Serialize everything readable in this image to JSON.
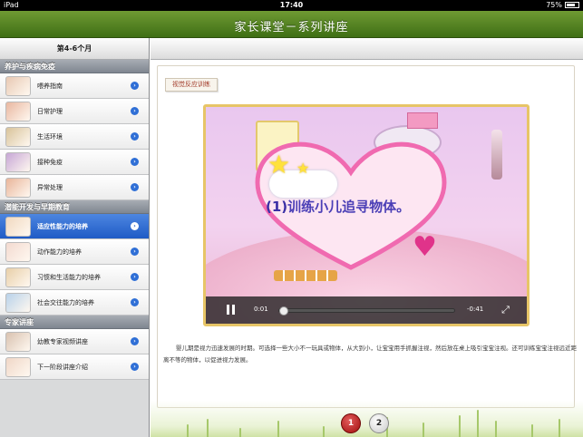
{
  "status_bar": {
    "device": "iPad",
    "time": "17:40",
    "battery": "75%",
    "battery_level": 0.75
  },
  "title_bar": {
    "title": "家长课堂－系列讲座"
  },
  "sidebar": {
    "header": "第4-6个月",
    "groups": [
      {
        "title": "养护与疾病免疫",
        "items": [
          {
            "label": "喂养指南",
            "thumb_color": "#e8c9b3"
          },
          {
            "label": "日常护理",
            "thumb_color": "#e9b7a0"
          },
          {
            "label": "生活环境",
            "thumb_color": "#d8c39a"
          },
          {
            "label": "接种免疫",
            "thumb_color": "#c7a7d6"
          },
          {
            "label": "异常处理",
            "thumb_color": "#e9b59a"
          }
        ]
      },
      {
        "title": "潜能开发与早期教育",
        "items": [
          {
            "label": "适应性能力的培养",
            "thumb_color": "#f1d9c0",
            "selected": true
          },
          {
            "label": "动作能力的培养",
            "thumb_color": "#f3dad0"
          },
          {
            "label": "习惯和生活能力的培养",
            "thumb_color": "#e8cfa8"
          },
          {
            "label": "社会交往能力的培养",
            "thumb_color": "#b9d2ea"
          }
        ]
      },
      {
        "title": "专家讲座",
        "items": [
          {
            "label": "幼教专家视频讲座",
            "thumb_color": "#d9c2b0"
          },
          {
            "label": "下一阶段讲座介绍",
            "thumb_color": "#f0d7c7"
          }
        ]
      }
    ]
  },
  "main": {
    "section_tag": "视觉反应训练",
    "video": {
      "caption_number": "(1)",
      "caption_text": "训练小儿追寻物体。",
      "current_time": "0:01",
      "remaining_time": "-0:41",
      "progress": 0.02
    },
    "description": "婴儿期是视力迅速发展的时期。可选择一些大小不一玩具或物体，从大到小，让宝宝用手抓握注视，然后放在桌上吸引宝宝注视。还可训练宝宝注视远近距离不等的物体，以促进视力发展。",
    "pagination": {
      "pages": [
        "1",
        "2"
      ],
      "current": "1"
    }
  },
  "colors": {
    "title_bar": "#4f7f1e",
    "selected": "#2a67d0",
    "page_active": "#b51414"
  }
}
